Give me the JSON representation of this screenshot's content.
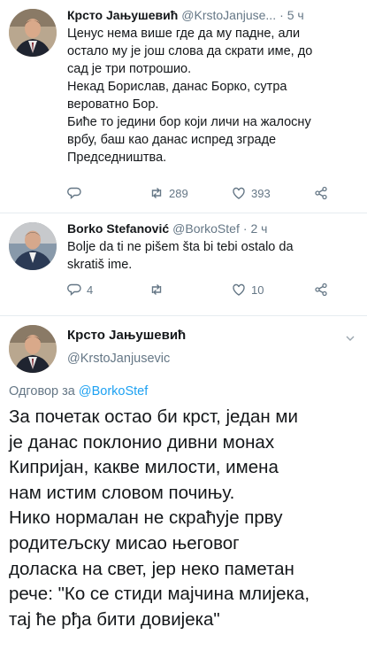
{
  "tweets": [
    {
      "name": "Крсто Јањушевић",
      "handle": "@KrstoJanjuse...",
      "time": "5 ч",
      "text": "Ценус нема више где да му падне, али\nостало му је још слова да скрати име, до\nсад је три потрошио.\nНекад Борислав, данас Борко, сутра\nвероватно Бор.\nБиће то једини бор који личи на жалосну\nврбу, баш као данас испред зграде\nПредседништва.",
      "replies": "",
      "retweets": "289",
      "likes": "393"
    },
    {
      "name": "Borko Stefanović",
      "handle": "@BorkoStef",
      "time": "2 ч",
      "text": "Bolje da ti ne pišem šta bi tebi ostalo da\nskratiš ime.",
      "replies": "4",
      "retweets": "",
      "likes": "10"
    }
  ],
  "main_tweet": {
    "name": "Крсто Јањушевић",
    "handle": "@KrstoJanjusevic",
    "reply_label": "Одговор за",
    "reply_to": "@BorkoStef",
    "text": "За почетак остао би крст, један ми\nје данас поклонио дивни монах\nКипријан, какве милости, имена\nнам истим словом почињу.\nНико нормалан не скраћује прву\nродитељску мисао његовог\nдоласка на свет, јер неко паметан\nрече: \"Ко се стиди мајчина млијека,\nтај ће рђа бити довијека\""
  },
  "colors": {
    "secondary": "#657786",
    "link": "#1da1f2",
    "divider": "#e6ecf0"
  }
}
